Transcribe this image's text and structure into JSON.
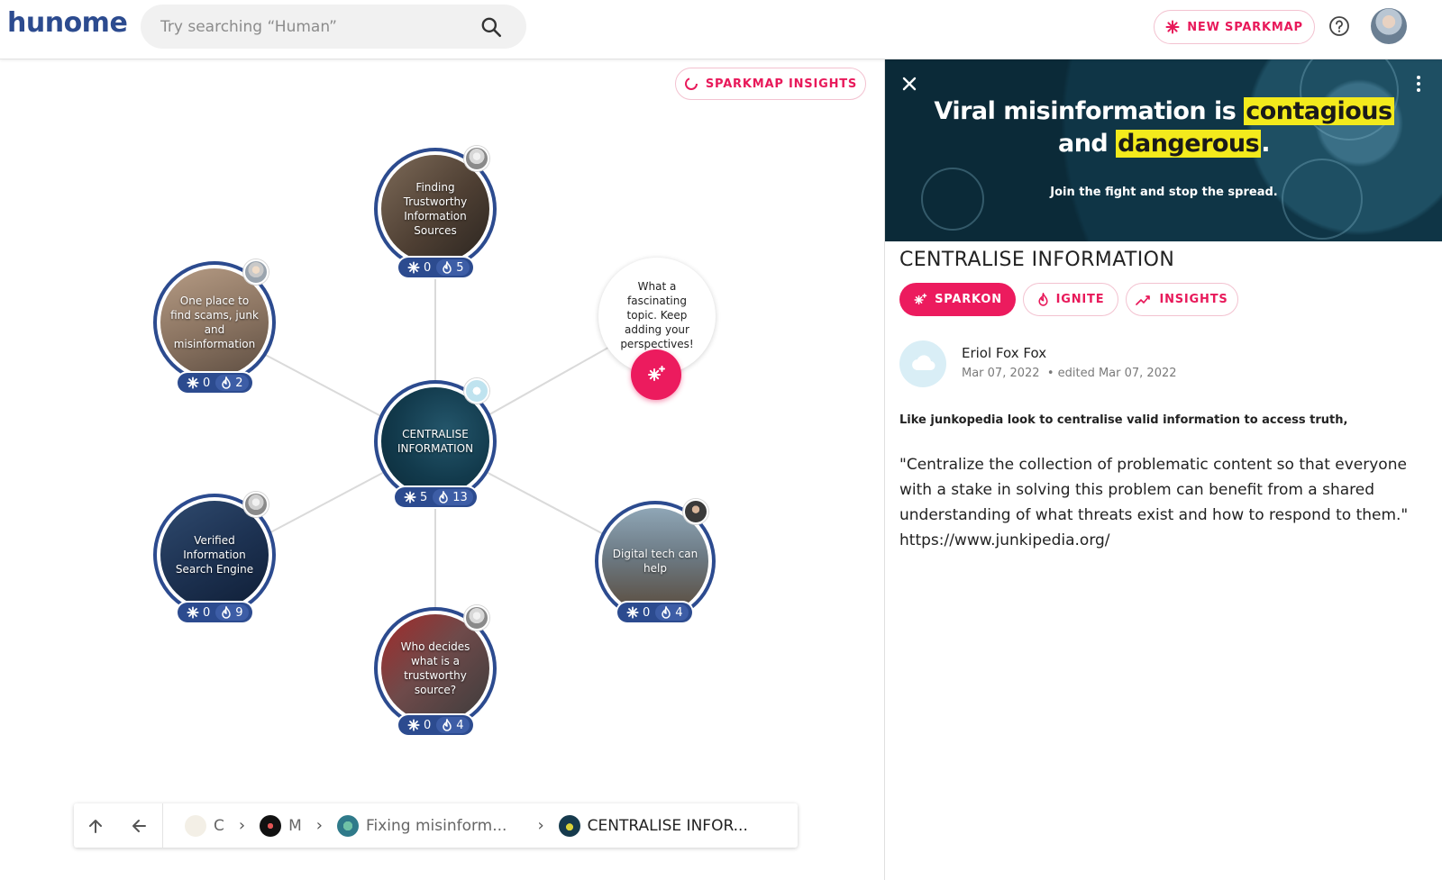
{
  "header": {
    "logo": "hunome",
    "search_placeholder": "Try searching “Human”",
    "new_sparkmap_label": "NEW SPARKMAP"
  },
  "map": {
    "insights_label": "SPARKMAP INSIGHTS",
    "center": {
      "title": "CENTRALISE INFORMATION",
      "sparks": "5",
      "ignites": "13"
    },
    "nodes": [
      {
        "title": "Finding Trustworthy Information Sources",
        "sparks": "0",
        "ignites": "5"
      },
      {
        "title": "One place to find scams, junk and misinformation",
        "sparks": "0",
        "ignites": "2"
      },
      {
        "title": "Verified Information Search Engine",
        "sparks": "0",
        "ignites": "9"
      },
      {
        "title": "Who decides what is a trustworthy source?",
        "sparks": "0",
        "ignites": "4"
      },
      {
        "title": "Digital tech can help",
        "sparks": "0",
        "ignites": "4"
      }
    ],
    "prompt_bubble": "What a fascinating topic. Keep adding your perspectives!"
  },
  "breadcrumb": {
    "items": [
      "C",
      "M",
      "Fixing misinform...",
      "CENTRALISE INFOR..."
    ]
  },
  "panel": {
    "banner": {
      "line1_pre": "Viral misinformation is ",
      "line1_hl": "contagious",
      "line2_pre": "and ",
      "line2_hl": "dangerous",
      "line2_post": ".",
      "line3": "Join the fight and stop the spread."
    },
    "title": "CENTRALISE INFORMATION",
    "buttons": {
      "sparkon": "SPARKON",
      "ignite": "IGNITE",
      "insights": "INSIGHTS"
    },
    "author": {
      "name": "Eriol Fox Fox",
      "date": "Mar 07, 2022",
      "edited": "• edited Mar 07, 2022"
    },
    "summary": "Like junkopedia look to centralise valid information to access truth,",
    "body": "\"Centralize the collection of problematic content so that everyone with a stake in solving this problem can benefit from a shared understanding of what threats exist and how to respond to them.\" https://www.junkipedia.org/"
  },
  "colors": {
    "brand": "#2c4b8f",
    "accent": "#ec1b5e",
    "highlight": "#f3ea1c"
  },
  "icons": [
    "search-icon",
    "spark-icon",
    "help-icon",
    "loading-icon",
    "fire-icon",
    "close-icon",
    "more-icon",
    "arrow-up-icon",
    "arrow-left-icon",
    "chevron-right-icon",
    "insights-icon",
    "add-spark-icon"
  ]
}
